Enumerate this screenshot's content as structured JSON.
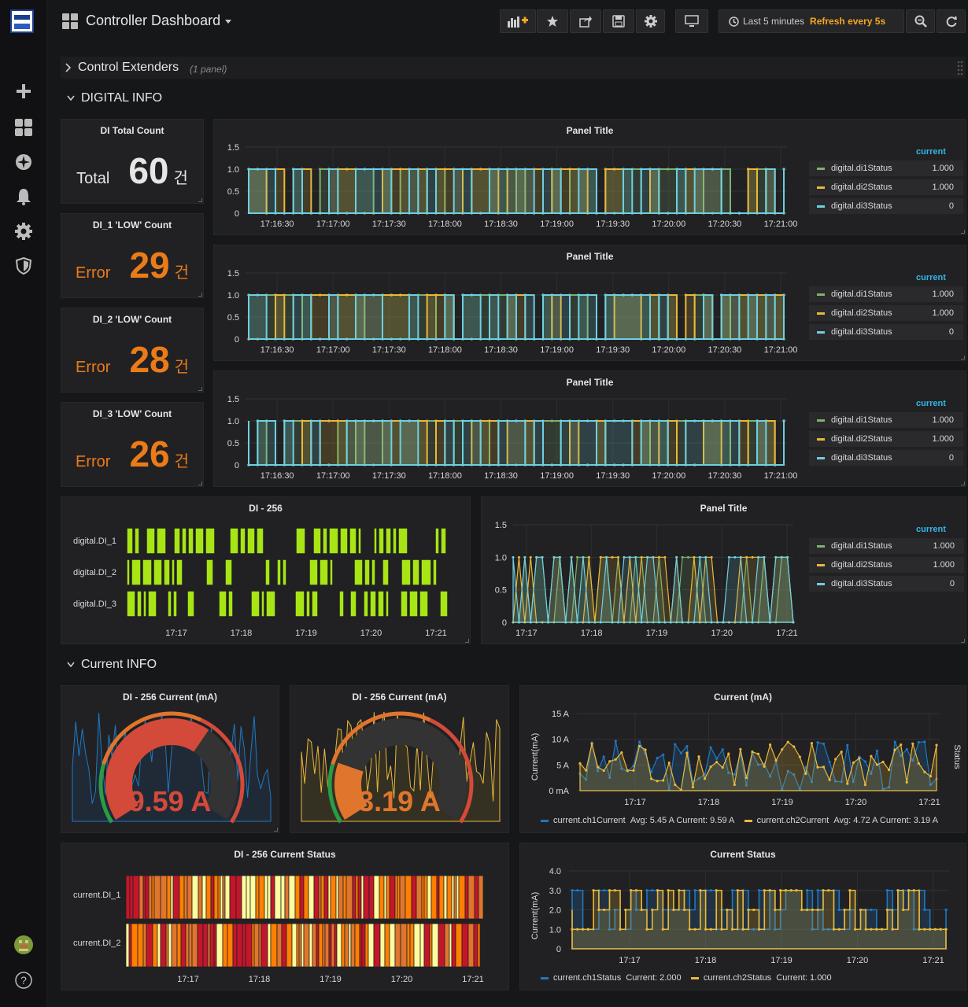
{
  "app": {
    "title": "Controller Dashboard"
  },
  "time": {
    "range": "Last 5 minutes",
    "refresh": "Refresh every 5s"
  },
  "toolbar": {
    "icons": [
      "add-panel-icon",
      "star-icon",
      "share-icon",
      "save-icon",
      "settings-icon",
      "tv-icon",
      "clock-icon",
      "zoom-out-icon",
      "refresh-icon"
    ]
  },
  "sidebar": {
    "icons": [
      "plus-icon",
      "dashboards-icon",
      "explore-icon",
      "alert-bell-icon",
      "gear-icon",
      "shield-icon",
      "user-avatar",
      "help-icon"
    ],
    "help": "?"
  },
  "rows": {
    "control": {
      "title": "Control Extenders",
      "count": "(1 panel)"
    },
    "digital": {
      "title": "DIGITAL INFO"
    },
    "current": {
      "title": "Current INFO"
    }
  },
  "stats": [
    {
      "title": "DI Total Count",
      "prefix": "Total",
      "value": "60",
      "unit": "건",
      "color": "#e6e6e6"
    },
    {
      "title": "DI_1 'LOW' Count",
      "prefix": "Error",
      "value": "29",
      "unit": "건",
      "color": "#eb7b18"
    },
    {
      "title": "DI_2 'LOW' Count",
      "prefix": "Error",
      "value": "28",
      "unit": "건",
      "color": "#eb7b18"
    },
    {
      "title": "DI_3 'LOW' Count",
      "prefix": "Error",
      "value": "26",
      "unit": "건",
      "color": "#eb7b18"
    }
  ],
  "panel_title": "Panel Title",
  "legend": {
    "header": "current",
    "rows": [
      {
        "name": "digital.di1Status",
        "value": "1.000",
        "color": "#7eb26d"
      },
      {
        "name": "digital.di2Status",
        "value": "1.000",
        "color": "#eab839"
      },
      {
        "name": "digital.di3Status",
        "value": "0",
        "color": "#6ed0e0"
      }
    ]
  },
  "di256": {
    "title": "DI - 256",
    "labels": [
      "digital.DI_1",
      "digital.DI_2",
      "digital.DI_3"
    ],
    "ticks": [
      "17:17",
      "17:18",
      "17:19",
      "17:20",
      "17:21"
    ]
  },
  "gauges": [
    {
      "title": "DI - 256 Current (mA)",
      "value": "9.59 A",
      "fraction": 0.64,
      "color": "#d44a3a"
    },
    {
      "title": "DI - 256 Current (mA)",
      "value": "3.19 A",
      "fraction": 0.21,
      "color": "#e0752d"
    }
  ],
  "current_chart": {
    "title": "Current (mA)",
    "ylabel": "Current(mA)",
    "y2label": "Status",
    "yticks": [
      "15 A",
      "10 A",
      "5 A",
      "0 mA"
    ],
    "legend": [
      {
        "name": "current.ch1Current",
        "stats": "Avg: 5.45 A  Current: 9.59 A",
        "color": "#1f78c1"
      },
      {
        "name": "current.ch2Current",
        "stats": "Avg: 4.72 A  Current: 3.19 A",
        "color": "#eab839"
      }
    ]
  },
  "current_status_heat": {
    "title": "DI - 256 Current Status",
    "labels": [
      "current.DI_1",
      "current.DI_2"
    ],
    "ticks": [
      "17:17",
      "17:18",
      "17:19",
      "17:20",
      "17:21"
    ]
  },
  "current_status": {
    "title": "Current Status",
    "ylabel": "Current(mA)",
    "yticks": [
      "4.0",
      "3.0",
      "2.0",
      "1.0",
      "0"
    ],
    "legend": [
      {
        "name": "current.ch1Status",
        "stats": "Current: 2.000",
        "color": "#1f78c1"
      },
      {
        "name": "current.ch2Status",
        "stats": "Current: 1.000",
        "color": "#eab839"
      }
    ]
  },
  "chart_data": [
    {
      "type": "line",
      "title": "Panel Title",
      "x": [
        "17:16:30",
        "17:17:00",
        "17:17:30",
        "17:18:00",
        "17:18:30",
        "17:19:00",
        "17:19:30",
        "17:20:00",
        "17:20:30",
        "17:21:00"
      ],
      "ylim": [
        0,
        1.5
      ],
      "yticks": [
        "1.5",
        "1.0",
        "0.5",
        "0"
      ],
      "series": [
        {
          "name": "digital.di1Status"
        },
        {
          "name": "digital.di2Status"
        },
        {
          "name": "digital.di3Status"
        }
      ]
    },
    {
      "type": "line",
      "title": "Panel Title",
      "x": [
        "17:16:30",
        "17:17:00",
        "17:17:30",
        "17:18:00",
        "17:18:30",
        "17:19:00",
        "17:19:30",
        "17:20:00",
        "17:20:30",
        "17:21:00"
      ],
      "ylim": [
        0,
        1.5
      ],
      "yticks": [
        "1.5",
        "1.0",
        "0.5",
        "0"
      ],
      "series": [
        {
          "name": "digital.di1Status"
        },
        {
          "name": "digital.di2Status"
        },
        {
          "name": "digital.di3Status"
        }
      ]
    },
    {
      "type": "line",
      "title": "Panel Title",
      "x": [
        "17:16:30",
        "17:17:00",
        "17:17:30",
        "17:18:00",
        "17:18:30",
        "17:19:00",
        "17:19:30",
        "17:20:00",
        "17:20:30",
        "17:21:00"
      ],
      "ylim": [
        0,
        1.5
      ],
      "yticks": [
        "1.5",
        "1.0",
        "0.5",
        "0"
      ],
      "series": [
        {
          "name": "digital.di1Status"
        },
        {
          "name": "digital.di2Status"
        },
        {
          "name": "digital.di3Status"
        }
      ]
    },
    {
      "type": "line",
      "title": "Panel Title",
      "x": [
        "17:17",
        "17:18",
        "17:19",
        "17:20",
        "17:21"
      ],
      "ylim": [
        0,
        1.5
      ],
      "yticks": [
        "1.5",
        "1.0",
        "0.5",
        "0"
      ],
      "series": [
        {
          "name": "digital.di1Status"
        },
        {
          "name": "digital.di2Status"
        },
        {
          "name": "digital.di3Status"
        }
      ]
    },
    {
      "type": "line",
      "title": "Current (mA)",
      "x": [
        "17:17",
        "17:18",
        "17:19",
        "17:20",
        "17:21"
      ],
      "ylim": [
        0,
        15
      ],
      "series": [
        {
          "name": "current.ch1Current",
          "avg": 5.45,
          "current": 9.59
        },
        {
          "name": "current.ch2Current",
          "avg": 4.72,
          "current": 3.19
        }
      ]
    },
    {
      "type": "line",
      "title": "Current Status",
      "x": [
        "17:17",
        "17:18",
        "17:19",
        "17:20",
        "17:21"
      ],
      "ylim": [
        0,
        4
      ],
      "series": [
        {
          "name": "current.ch1Status",
          "current": 2.0
        },
        {
          "name": "current.ch2Status",
          "current": 1.0
        }
      ]
    }
  ]
}
